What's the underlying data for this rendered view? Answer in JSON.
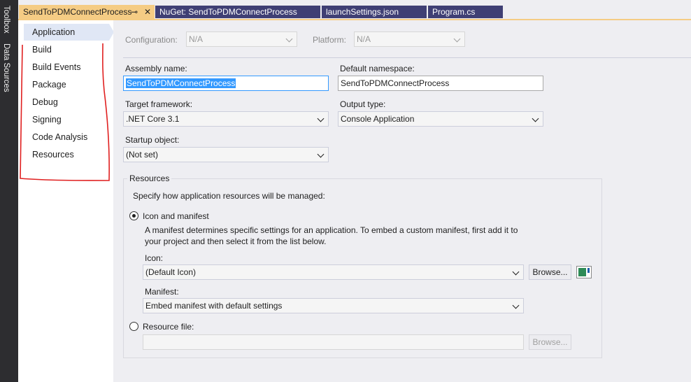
{
  "toolstrip": {
    "items": [
      "Toolbox",
      "Data Sources"
    ]
  },
  "tabs": [
    {
      "label": "SendToPDMConnectProcess",
      "active": true,
      "pin_icon": "⊸",
      "close_icon": "✕"
    },
    {
      "label": "NuGet: SendToPDMConnectProcess",
      "active": false
    },
    {
      "label": "launchSettings.json",
      "active": false
    },
    {
      "label": "Program.cs",
      "active": false
    }
  ],
  "nav": {
    "items": [
      "Application",
      "Build",
      "Build Events",
      "Package",
      "Debug",
      "Signing",
      "Code Analysis",
      "Resources"
    ],
    "selected": "Application"
  },
  "config": {
    "configuration_label": "Configuration:",
    "configuration_value": "N/A",
    "platform_label": "Platform:",
    "platform_value": "N/A"
  },
  "form": {
    "assembly_name_label": "Assembly name:",
    "assembly_name_value": "SendToPDMConnectProcess",
    "default_namespace_label": "Default namespace:",
    "default_namespace_value": "SendToPDMConnectProcess",
    "target_framework_label": "Target framework:",
    "target_framework_value": ".NET Core 3.1",
    "output_type_label": "Output type:",
    "output_type_value": "Console Application",
    "startup_object_label": "Startup object:",
    "startup_object_value": "(Not set)"
  },
  "resources": {
    "group_label": "Resources",
    "intro": "Specify how application resources will be managed:",
    "icon_manifest_label": "Icon and manifest",
    "manifest_desc_1": "A manifest determines specific settings for an application. To embed a custom manifest, first add it to",
    "manifest_desc_2": "your project and then select it from the list below.",
    "icon_label": "Icon:",
    "icon_value": "(Default Icon)",
    "browse_label": "Browse...",
    "manifest_label": "Manifest:",
    "manifest_value": "Embed manifest with default settings",
    "resource_file_label": "Resource file:",
    "resource_file_value": "",
    "browse2_label": "Browse...",
    "selected_option": "Icon and manifest"
  },
  "colors": {
    "accent": "#f5cc84",
    "tab_inactive": "#3f3f74",
    "selection": "#3399ff",
    "annotation": "#e02020"
  }
}
